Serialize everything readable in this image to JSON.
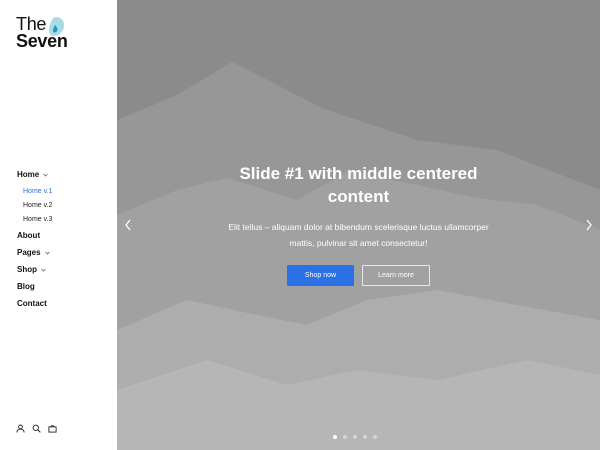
{
  "brand": {
    "line1": "The",
    "line2": "Seven",
    "logo_icon": "water-drop-blob-icon",
    "accent_color": "#3aa9c9"
  },
  "nav": {
    "items": [
      {
        "label": "Home",
        "has_children": true,
        "children": [
          {
            "label": "Home v.1",
            "active": true
          },
          {
            "label": "Home v.2",
            "active": false
          },
          {
            "label": "Home v.3",
            "active": false
          }
        ]
      },
      {
        "label": "About",
        "has_children": false
      },
      {
        "label": "Pages",
        "has_children": true
      },
      {
        "label": "Shop",
        "has_children": true
      },
      {
        "label": "Blog",
        "has_children": false
      },
      {
        "label": "Contact",
        "has_children": false
      }
    ],
    "active_color": "#2a6fd6"
  },
  "tools": [
    {
      "icon": "user-icon"
    },
    {
      "icon": "search-icon"
    },
    {
      "icon": "shopping-bag-icon"
    }
  ],
  "slider": {
    "title": "Slide #1 with middle centered content",
    "text": "Elit tellus – aliquam dolor at bibendum scelerisque luctus ullamcorper mattis, pulvinar sit amet consectetur!",
    "primary_button": "Shop now",
    "secondary_button": "Learn more",
    "primary_color": "#2b70e5",
    "slide_count": 5,
    "active_slide": 1
  }
}
